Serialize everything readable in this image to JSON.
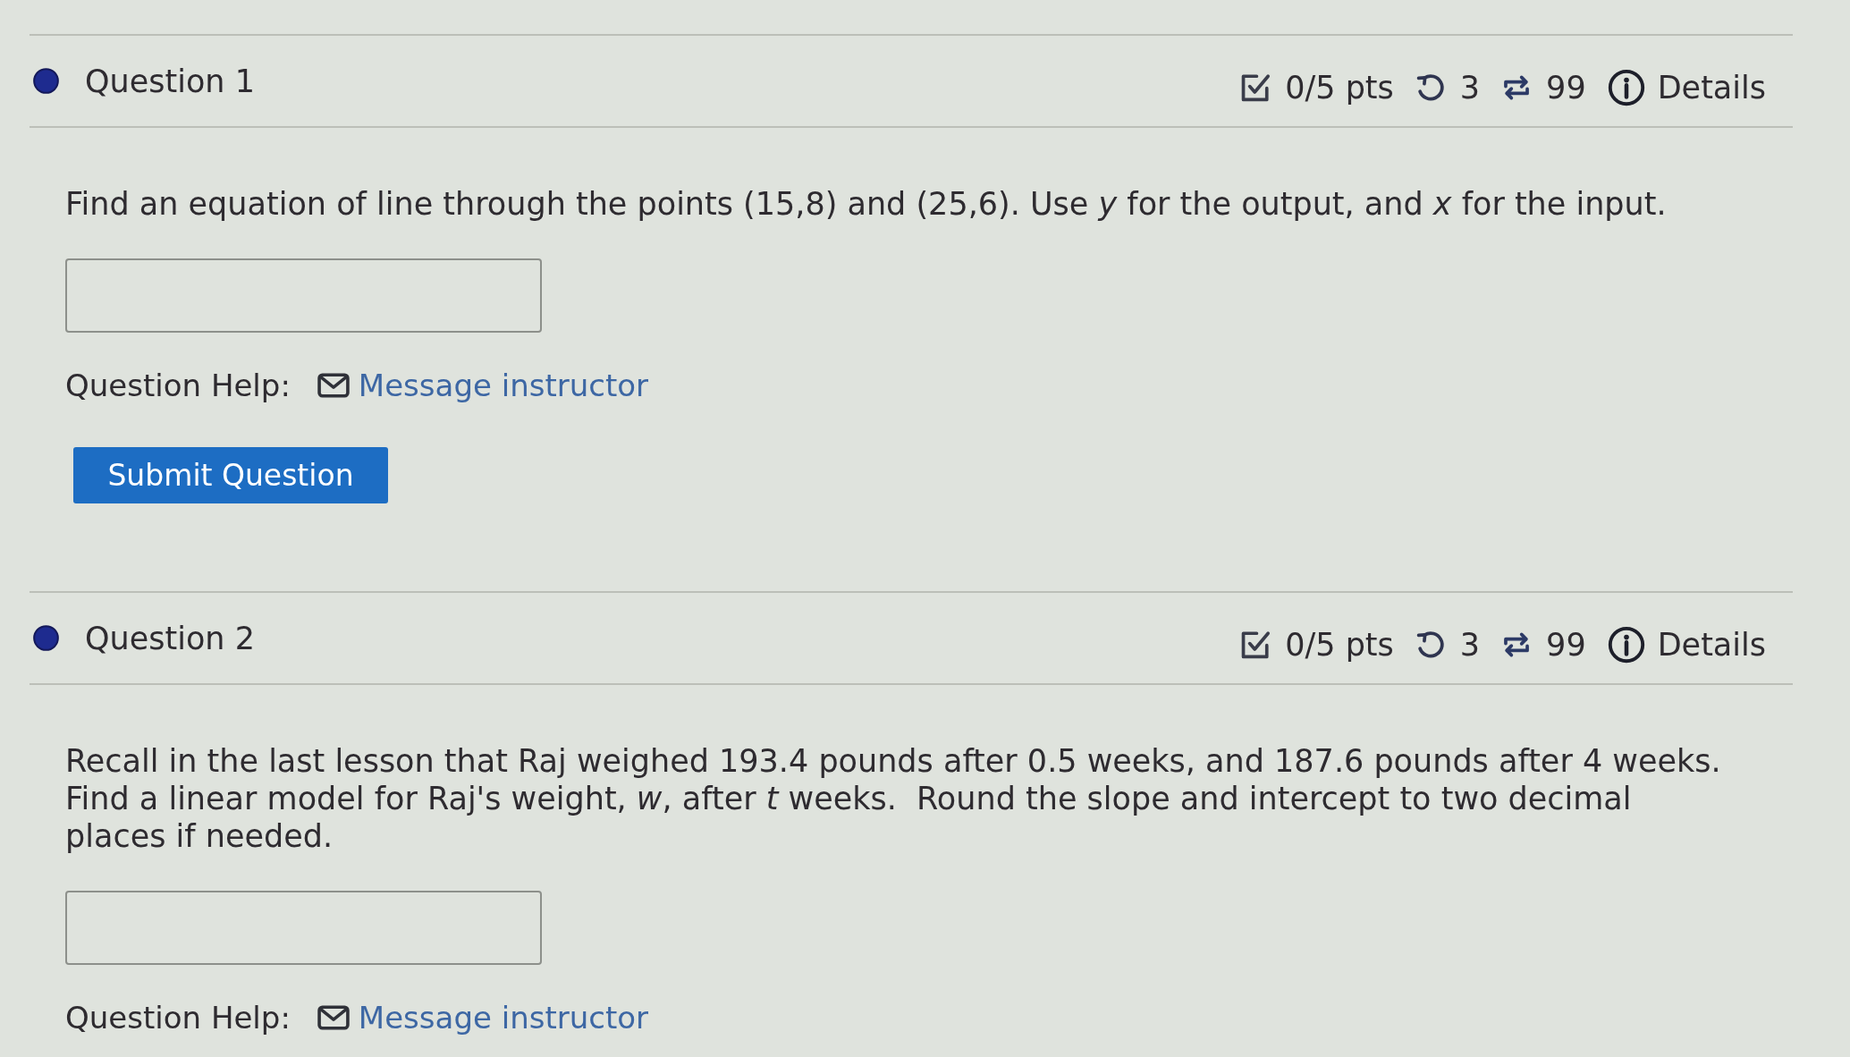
{
  "questions": [
    {
      "title": "Question 1",
      "score": "0/5 pts",
      "attempts": "3",
      "retries": "99",
      "details": "Details",
      "prompt": "Find an equation of line through the points (15,8) and (25,6). Use *y* for the output, and *x* for the input.",
      "help_label": "Question Help:",
      "help_link": "Message instructor",
      "submit": "Submit Question"
    },
    {
      "title": "Question 2",
      "score": "0/5 pts",
      "attempts": "3",
      "retries": "99",
      "details": "Details",
      "prompt": "Recall in the last lesson that Raj weighed 193.4 pounds after 0.5 weeks, and 187.6 pounds after 4 weeks. Find a linear model for Raj's weight, *w*, after *t* weeks.  Round the slope and intercept to two decimal places if needed.",
      "help_label": "Question Help:",
      "help_link": "Message instructor"
    }
  ]
}
